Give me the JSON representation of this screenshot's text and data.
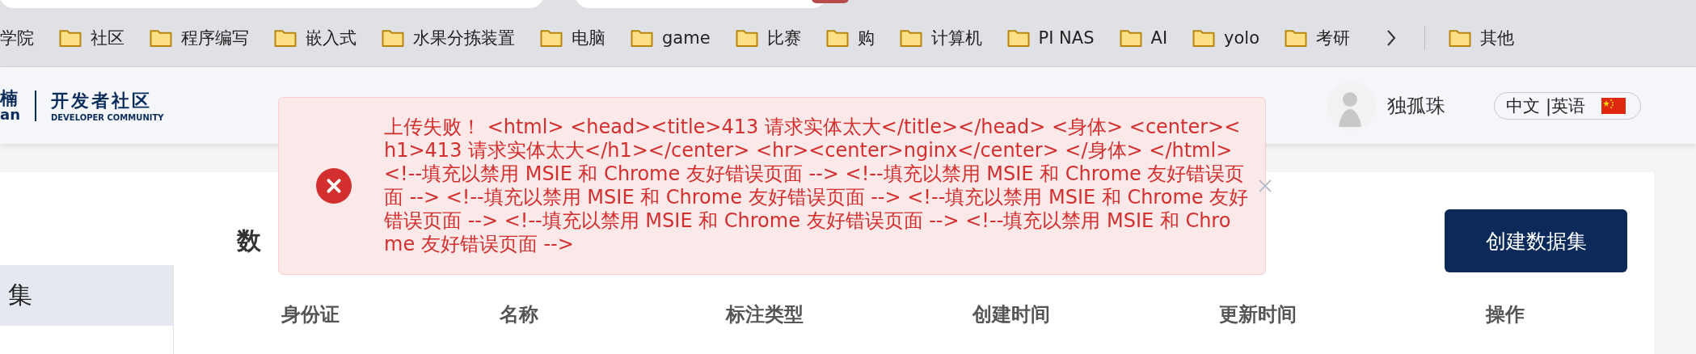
{
  "bookmarks_bar": {
    "cut_item": {
      "label": "学院"
    },
    "items": [
      {
        "label": "社区"
      },
      {
        "label": "程序编写"
      },
      {
        "label": "嵌入式"
      },
      {
        "label": "水果分拣装置"
      },
      {
        "label": "电脑"
      },
      {
        "label": "game"
      },
      {
        "label": "比赛"
      },
      {
        "label": "购"
      },
      {
        "label": "计算机"
      },
      {
        "label": "PI NAS"
      },
      {
        "label": "AI"
      },
      {
        "label": "yolo"
      },
      {
        "label": "考研"
      }
    ],
    "other": {
      "label": "其他"
    }
  },
  "header": {
    "logo": {
      "mark": "楠",
      "mark_sub": "an",
      "title": "开发者社区",
      "subtitle": "DEVELOPER COMMUNITY"
    },
    "user": {
      "name": "独孤珠"
    },
    "language": {
      "label": "中文 |英语"
    }
  },
  "sidebar": {
    "items": [
      {
        "label": "集",
        "selected": true
      }
    ]
  },
  "page": {
    "title": "数",
    "create_button": "创建数据集"
  },
  "table": {
    "columns": [
      "身份证",
      "名称",
      "标注类型",
      "创建时间",
      "更新时间",
      "操作"
    ]
  },
  "toast": {
    "message": "上传失败！ <html> <head><title>413 请求实体太大</title></head> <身体> <center><h1>413 请求实体太大</h1></center> <hr><center>nginx</center> </身体> </html> <!--填充以禁用 MSIE 和 Chrome 友好错误页面 --> <!--填充以禁用 MSIE 和 Chrome 友好错误页面 --> <!--填充以禁用 MSIE 和 Chrome 友好错误页面 --> <!--填充以禁用 MSIE 和 Chrome 友好错误页面 --> <!--填充以禁用 MSIE 和 Chrome 友好错误页面 --> <!--填充以禁用 MSIE 和 Chrome 友好错误页面 -->"
  }
}
